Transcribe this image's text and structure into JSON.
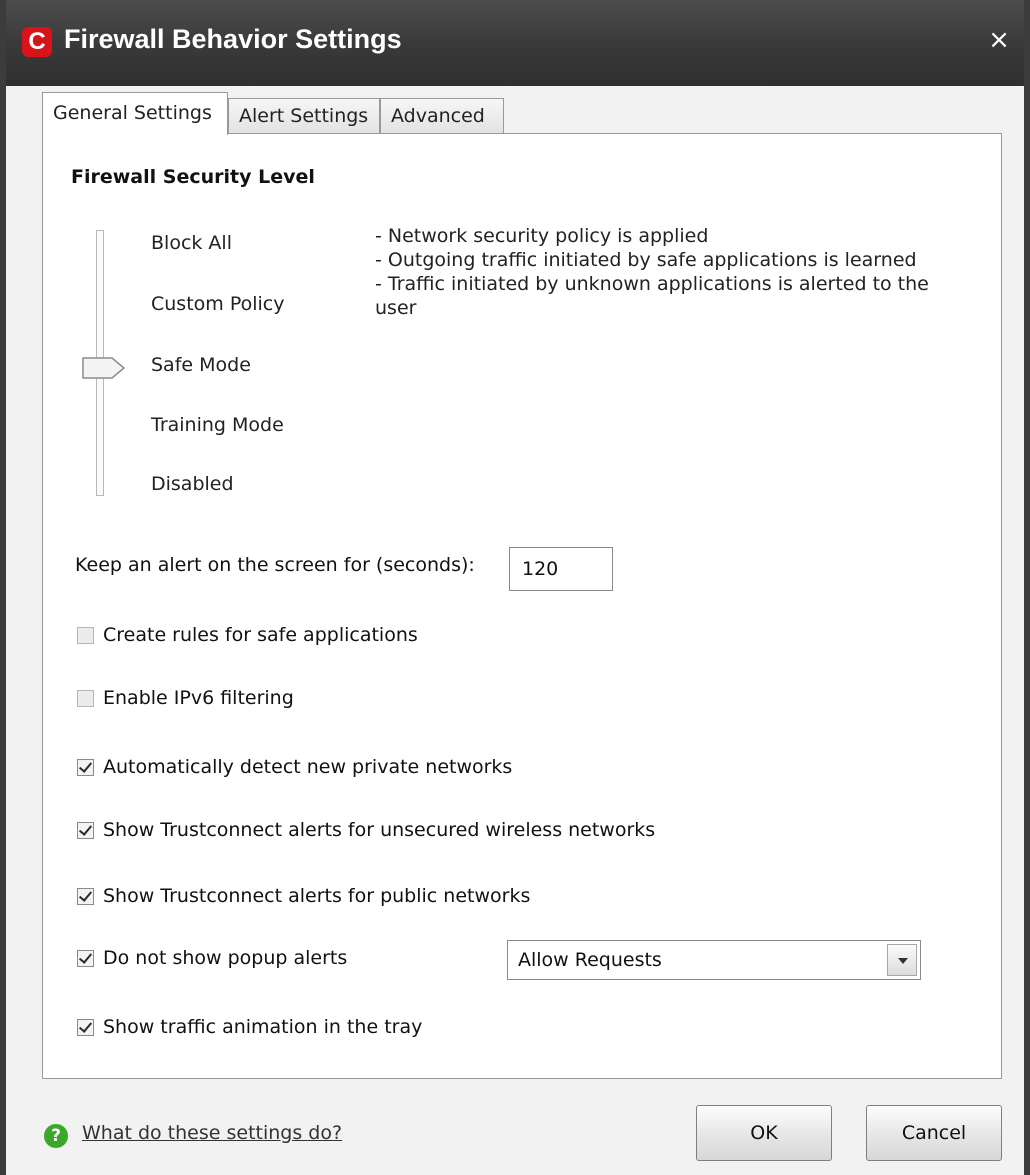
{
  "window": {
    "title": "Firewall Behavior Settings",
    "logo_letter": "C",
    "close_glyph": "×"
  },
  "tabs": [
    {
      "label": "General Settings",
      "active": true
    },
    {
      "label": "Alert Settings",
      "active": false
    },
    {
      "label": "Advanced",
      "active": false
    }
  ],
  "security": {
    "title": "Firewall Security Level",
    "levels": [
      "Block All",
      "Custom Policy",
      "Safe Mode",
      "Training Mode",
      "Disabled"
    ],
    "selected": "Safe Mode",
    "description": [
      "- Network security policy is applied",
      "- Outgoing traffic initiated by safe applications is learned",
      "- Traffic initiated by unknown applications is alerted to the user"
    ]
  },
  "alert_duration": {
    "label": "Keep an alert on the screen for (seconds):",
    "value": "120"
  },
  "checkboxes": [
    {
      "label": "Create rules for safe applications",
      "checked": false
    },
    {
      "label": "Enable IPv6 filtering",
      "checked": false
    },
    {
      "label": "Automatically detect new private networks",
      "checked": true
    },
    {
      "label": "Show Trustconnect alerts for unsecured wireless networks",
      "checked": true
    },
    {
      "label": "Show Trustconnect alerts for public networks",
      "checked": true
    },
    {
      "label": "Do not show popup alerts",
      "checked": true
    },
    {
      "label": "Show traffic animation in the tray",
      "checked": true
    }
  ],
  "popup_action": {
    "selected": "Allow Requests"
  },
  "footer": {
    "help_icon": "question-circle-icon",
    "help_link": "What do these settings do?",
    "ok_label": "OK",
    "cancel_label": "Cancel"
  },
  "colors": {
    "titlebar": "#3a3a3a",
    "brand_red": "#d8141b",
    "help_green": "#3aa62a"
  }
}
